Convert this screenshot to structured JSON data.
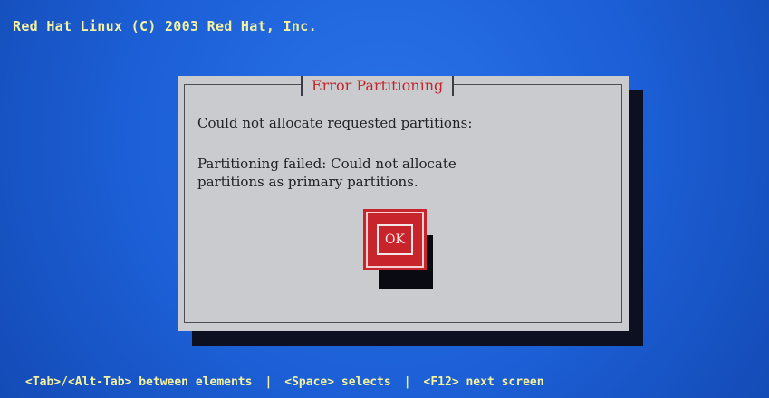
{
  "screen": {
    "title": "Red Hat Linux (C) 2003 Red Hat, Inc."
  },
  "dialog": {
    "title": "Error Partitioning",
    "message_1": "Could not allocate requested partitions:",
    "message_2": "Partitioning failed: Could not allocate\npartitions as primary partitions.",
    "ok_label": "OK"
  },
  "help": {
    "item_1": "<Tab>/<Alt-Tab> between elements",
    "sep_1": "|",
    "item_2": "<Space> selects",
    "sep_2": "|",
    "item_3": "<F12> next screen"
  },
  "colors": {
    "background": "#1f62d8",
    "title_text": "#f4f2a0",
    "dialog_bg": "#c9cbcf",
    "dialog_title": "#c0282b",
    "button": "#c7252b"
  }
}
